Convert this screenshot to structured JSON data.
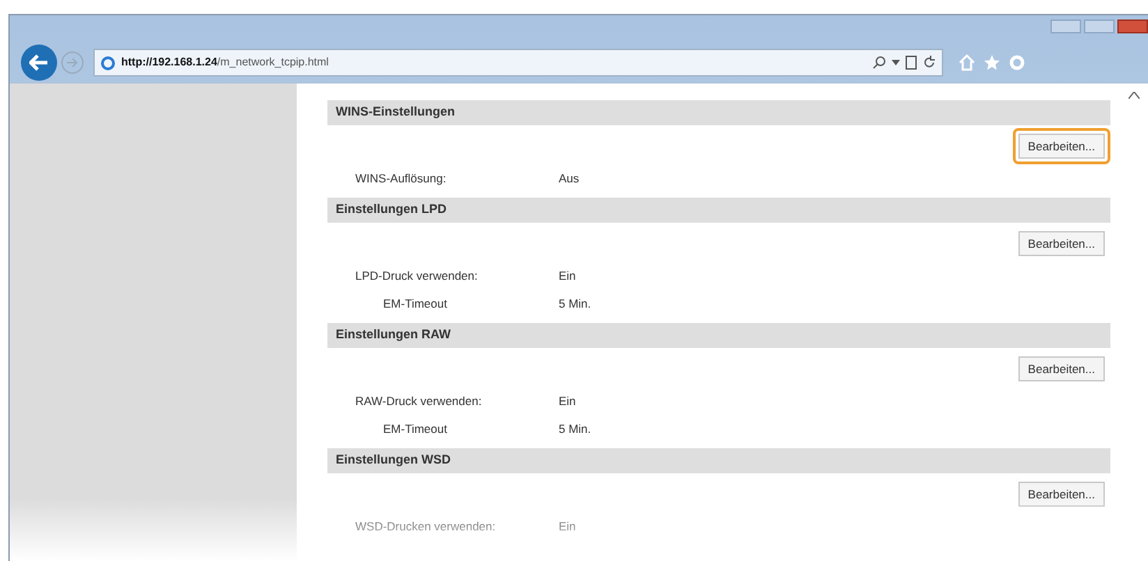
{
  "browser": {
    "url_host": "http://192.168.1.24",
    "url_path": "/m_network_tcpip.html"
  },
  "sections": [
    {
      "title": "WINS-Einstellungen",
      "button": {
        "label": "Bearbeiten...",
        "highlighted": true
      },
      "rows": [
        {
          "label": "WINS-Auflösung:",
          "value": "Aus",
          "indented": false
        }
      ]
    },
    {
      "title": "Einstellungen LPD",
      "button": {
        "label": "Bearbeiten...",
        "highlighted": false
      },
      "rows": [
        {
          "label": "LPD-Druck verwenden:",
          "value": "Ein",
          "indented": false
        },
        {
          "label": "EM-Timeout",
          "value": "5 Min.",
          "indented": true
        }
      ]
    },
    {
      "title": "Einstellungen RAW",
      "button": {
        "label": "Bearbeiten...",
        "highlighted": false
      },
      "rows": [
        {
          "label": "RAW-Druck verwenden:",
          "value": "Ein",
          "indented": false
        },
        {
          "label": "EM-Timeout",
          "value": "5 Min.",
          "indented": true
        }
      ]
    },
    {
      "title": "Einstellungen WSD",
      "button": {
        "label": "Bearbeiten...",
        "highlighted": false
      },
      "rows": [
        {
          "label": "WSD-Drucken verwenden:",
          "value": "Ein",
          "indented": false
        }
      ]
    }
  ]
}
